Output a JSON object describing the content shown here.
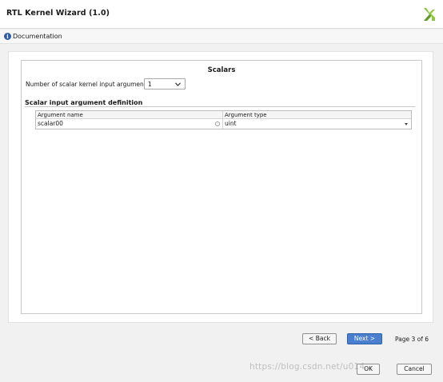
{
  "window": {
    "title": "RTL Kernel Wizard (1.0)"
  },
  "docbar": {
    "link": "Documentation",
    "icon": "info-icon"
  },
  "panel": {
    "title": "Scalars",
    "num_args_label": "Number of scalar kernel input arguments",
    "num_args_value": "1",
    "section_title": "Scalar input argument definition",
    "table": {
      "headers": [
        "Argument name",
        "Argument type"
      ],
      "rows": [
        {
          "name": "scalar00",
          "type": "uint"
        }
      ]
    }
  },
  "nav": {
    "back_label": "< Back",
    "next_label": "Next >",
    "page_info": "Page 3 of 6",
    "ok_label": "OK",
    "cancel_label": "Cancel"
  },
  "watermark": "https://blog.csdn.net/u014...",
  "colors": {
    "accent": "#4a7fd0",
    "logo": "#8dc63f",
    "info": "#2f5aa8"
  }
}
